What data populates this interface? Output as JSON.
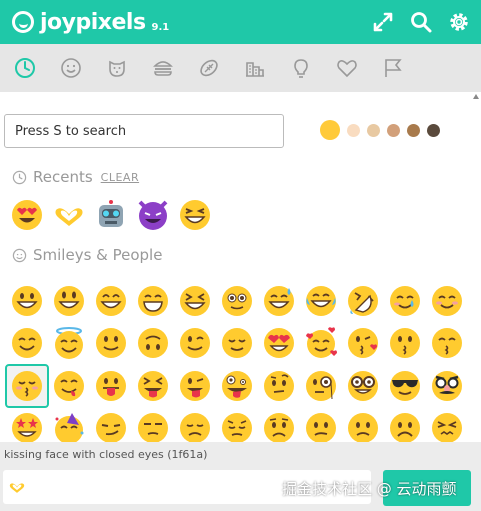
{
  "app": {
    "name": "joypixels",
    "version": "9.1"
  },
  "header_icons": [
    "expand-icon",
    "search-icon",
    "gear-icon"
  ],
  "categories": [
    "recent-clock-icon",
    "smileys-icon",
    "animals-icon",
    "food-icon",
    "activity-icon",
    "travel-icon",
    "objects-icon",
    "symbols-icon",
    "flags-icon"
  ],
  "search": {
    "placeholder": "Press S to search",
    "value": ""
  },
  "skin_tones": [
    "#ffca3a",
    "#f9dcc0",
    "#e8c9a2",
    "#d2a07a",
    "#a87a4c",
    "#5a4a3c"
  ],
  "recents": {
    "title": "Recents",
    "clear_label": "CLEAR",
    "items": [
      "heart-eyes",
      "heart-hands",
      "robot",
      "smiling-devil",
      "grinning-squint"
    ]
  },
  "smileys": {
    "title": "Smileys & People"
  },
  "footer": {
    "description": "kissing face with closed eyes (1f61a)",
    "output_emoji": "heart-hands"
  },
  "watermark": "掘金技术社区 @ 云动雨颤",
  "colors": {
    "accent": "#1fc8a8",
    "category_bar": "#e6e6e6",
    "footer": "#ececec"
  }
}
